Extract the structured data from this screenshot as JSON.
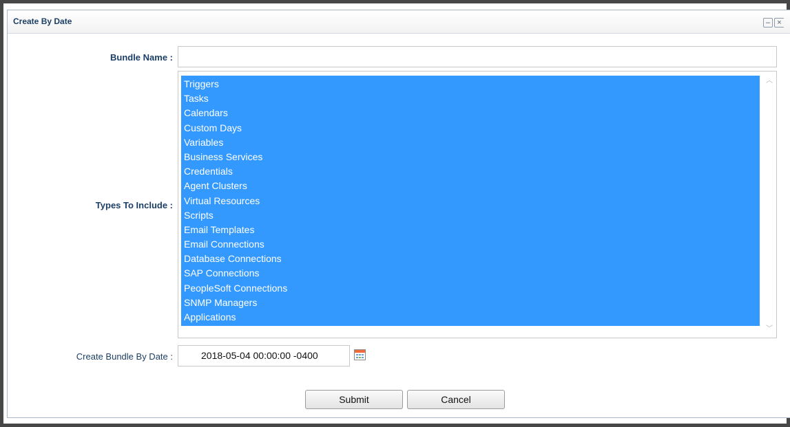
{
  "window": {
    "title": "Create By Date",
    "minimize_glyph": "–",
    "close_glyph": "×"
  },
  "form": {
    "bundle_name": {
      "label": "Bundle Name :",
      "value": ""
    },
    "types_to_include": {
      "label": "Types To Include :",
      "selected_color": "#3399ff",
      "items": [
        "Triggers",
        "Tasks",
        "Calendars",
        "Custom Days",
        "Variables",
        "Business Services",
        "Credentials",
        "Agent Clusters",
        "Virtual Resources",
        "Scripts",
        "Email Templates",
        "Email Connections",
        "Database Connections",
        "SAP Connections",
        "PeopleSoft Connections",
        "SNMP Managers",
        "Applications"
      ]
    },
    "create_bundle_by_date": {
      "label": "Create Bundle By Date :",
      "value": "2018-05-04 00:00:00 -0400"
    }
  },
  "buttons": {
    "submit_label": "Submit",
    "cancel_label": "Cancel"
  }
}
